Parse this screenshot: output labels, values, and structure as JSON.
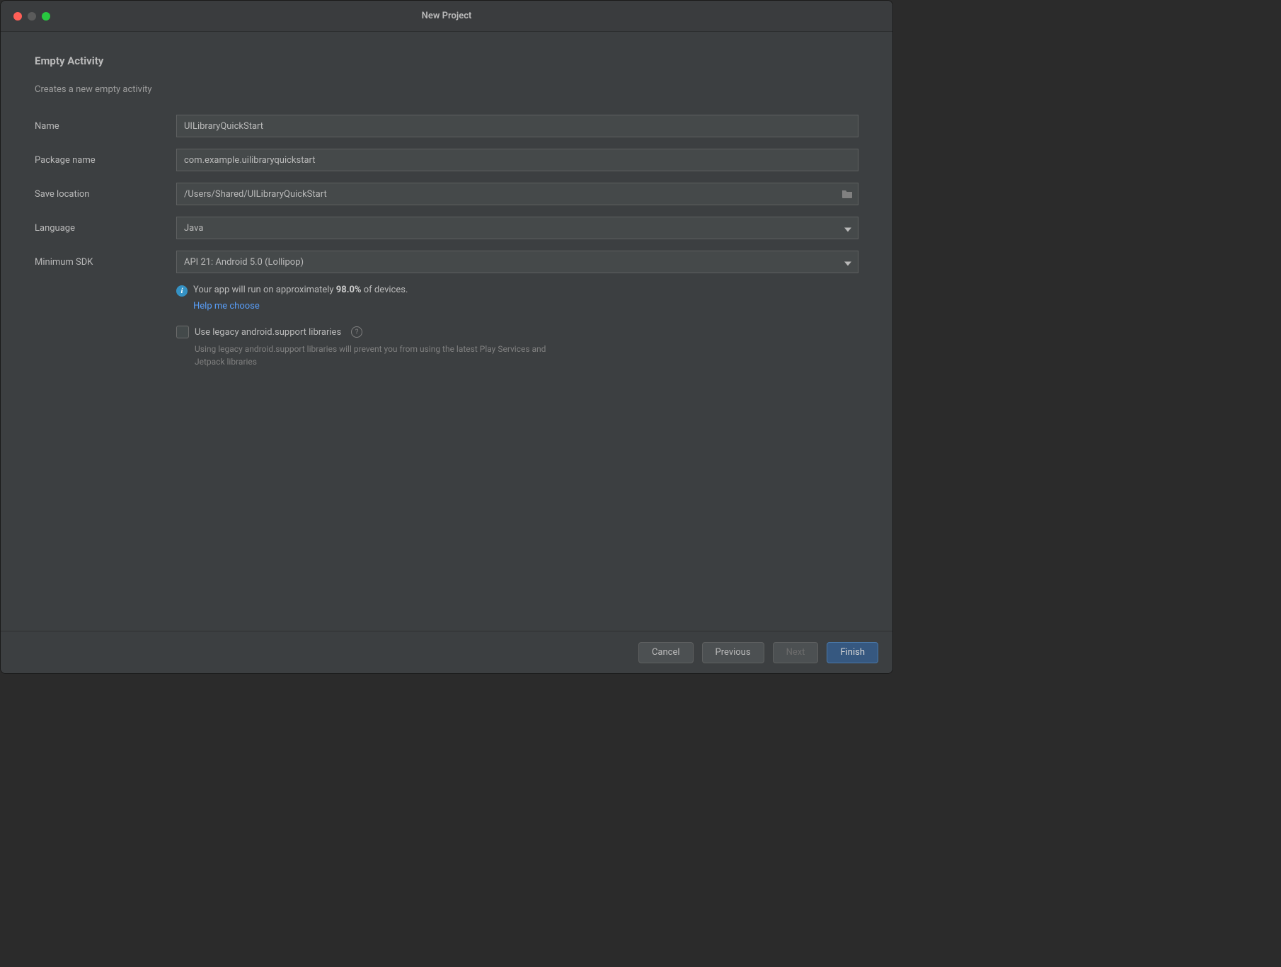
{
  "window": {
    "title": "New Project"
  },
  "section": {
    "heading": "Empty Activity",
    "description": "Creates a new empty activity"
  },
  "form": {
    "name": {
      "label": "Name",
      "value": "UILibraryQuickStart"
    },
    "package": {
      "label": "Package name",
      "value": "com.example.uilibraryquickstart"
    },
    "save_location": {
      "label": "Save location",
      "value": "/Users/Shared/UILibraryQuickStart"
    },
    "language": {
      "label": "Language",
      "value": "Java"
    },
    "minimum_sdk": {
      "label": "Minimum SDK",
      "value": "API 21: Android 5.0 (Lollipop)"
    }
  },
  "info": {
    "text_pre": "Your app will run on approximately ",
    "percent": "98.0%",
    "text_post": " of devices.",
    "help_link": "Help me choose"
  },
  "legacy": {
    "label": "Use legacy android.support libraries",
    "description": "Using legacy android.support libraries will prevent you from using the latest Play Services and Jetpack libraries"
  },
  "buttons": {
    "cancel": "Cancel",
    "previous": "Previous",
    "next": "Next",
    "finish": "Finish"
  }
}
